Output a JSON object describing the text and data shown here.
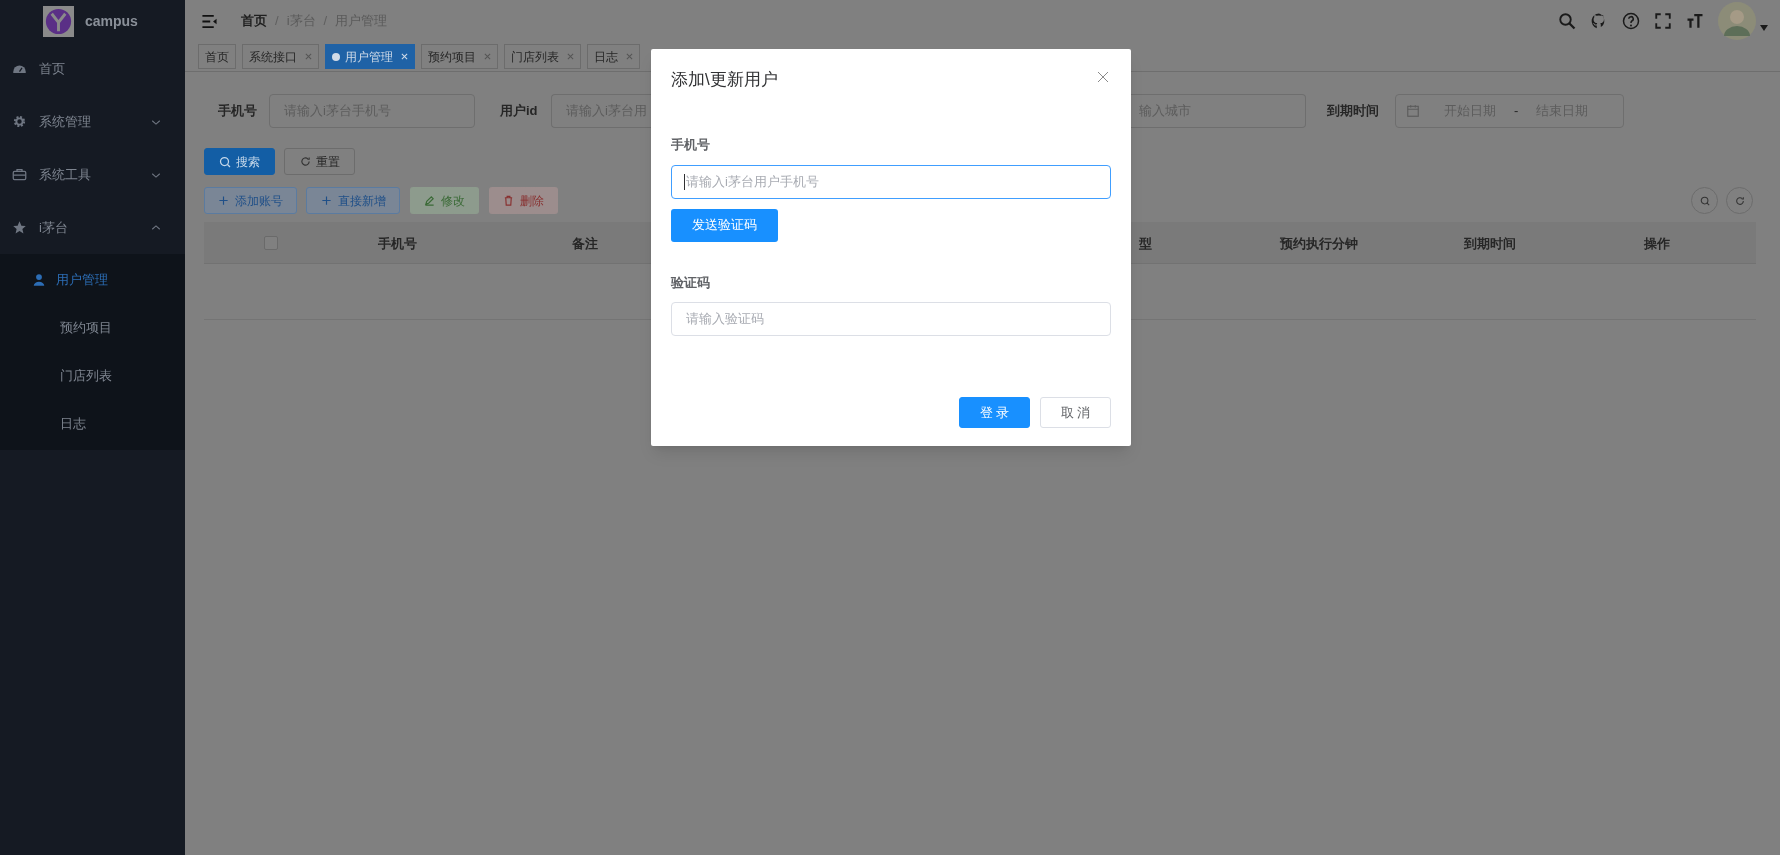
{
  "sidebar": {
    "brand": "campus",
    "items": [
      {
        "label": "首页",
        "selected": false
      },
      {
        "label": "系统管理",
        "expanded": false,
        "selected": false
      },
      {
        "label": "系统工具",
        "expanded": false,
        "selected": false
      },
      {
        "label": "i茅台",
        "expanded": true,
        "selected": false,
        "children": [
          {
            "label": "用户管理",
            "selected": true
          },
          {
            "label": "预约项目",
            "selected": false
          },
          {
            "label": "门店列表",
            "selected": false
          },
          {
            "label": "日志",
            "selected": false
          }
        ]
      }
    ]
  },
  "header": {
    "separator": "/",
    "breadcrumb": [
      {
        "label": "首页",
        "current": false
      },
      {
        "label": "i茅台",
        "current": true
      },
      {
        "label": "用户管理",
        "current": true
      }
    ]
  },
  "tabs": [
    {
      "label": "首页",
      "selected": false,
      "closable": false
    },
    {
      "label": "系统接口",
      "selected": false,
      "closable": true
    },
    {
      "label": "用户管理",
      "selected": true,
      "closable": true
    },
    {
      "label": "预约项目",
      "selected": false,
      "closable": true
    },
    {
      "label": "门店列表",
      "selected": false,
      "closable": true
    },
    {
      "label": "日志",
      "selected": false,
      "closable": true
    }
  ],
  "filters": {
    "phone": {
      "label": "手机号",
      "placeholder": "请输入i茅台手机号"
    },
    "user_id": {
      "label": "用户id",
      "placeholder": "请输入i茅台用"
    },
    "city": {
      "placeholder": "输入城市"
    },
    "expiry": {
      "label": "到期时间",
      "start_placeholder": "开始日期",
      "separator": "-",
      "end_placeholder": "结束日期"
    }
  },
  "search_buttons": [
    {
      "label": "搜索",
      "kind": "primary"
    },
    {
      "label": "重置",
      "kind": "plain"
    }
  ],
  "actions": [
    {
      "label": "添加账号",
      "kind": "blue",
      "disabled": false
    },
    {
      "label": "直接新增",
      "kind": "blue",
      "disabled": false
    },
    {
      "label": "修改",
      "kind": "green",
      "disabled": true
    },
    {
      "label": "删除",
      "kind": "red",
      "disabled": true
    }
  ],
  "table": {
    "columns": [
      "手机号",
      "备注",
      "型",
      "预约执行分钟",
      "到期时间",
      "操作"
    ],
    "all_checked": false
  },
  "dialog": {
    "title": "添加\\更新用户",
    "phone": {
      "label": "手机号",
      "placeholder": "请输入i茅台用户手机号",
      "focused": true
    },
    "send_code": "发送验证码",
    "code": {
      "label": "验证码",
      "placeholder": "请输入验证码",
      "focused": false
    },
    "buttons": [
      {
        "label": "登 录",
        "kind": "primary"
      },
      {
        "label": "取 消",
        "kind": "plain"
      }
    ]
  }
}
